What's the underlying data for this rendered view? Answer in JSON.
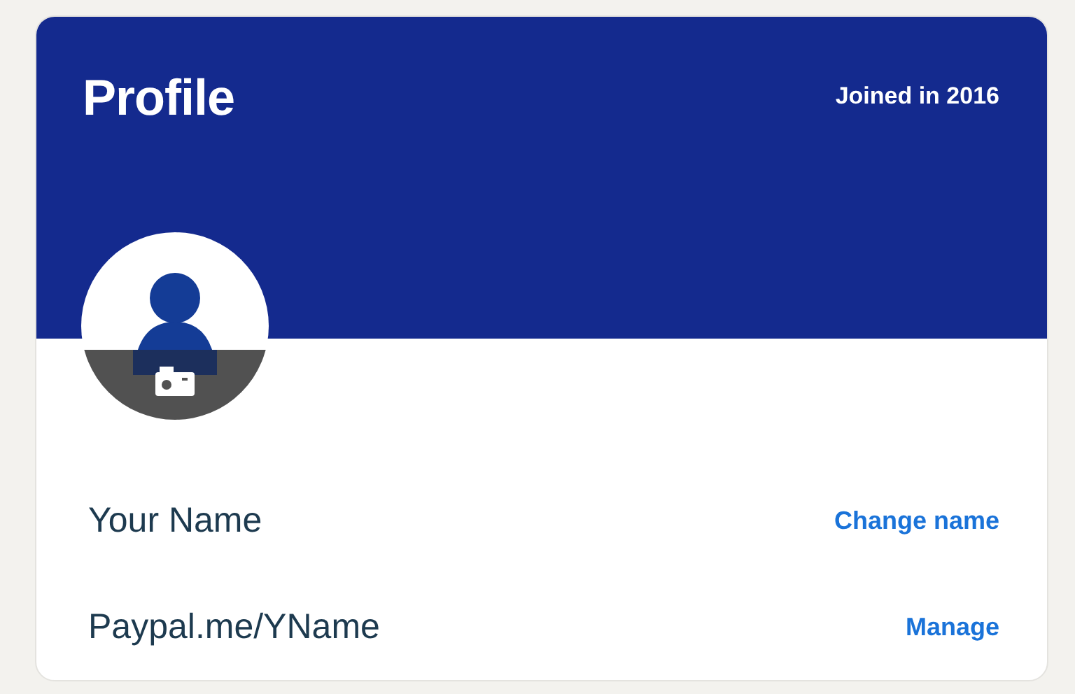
{
  "profile": {
    "title": "Profile",
    "joined": "Joined in 2016"
  },
  "rows": [
    {
      "value": "Your Name",
      "action": "Change name"
    },
    {
      "value": "Paypal.me/YName",
      "action": "Manage"
    }
  ]
}
